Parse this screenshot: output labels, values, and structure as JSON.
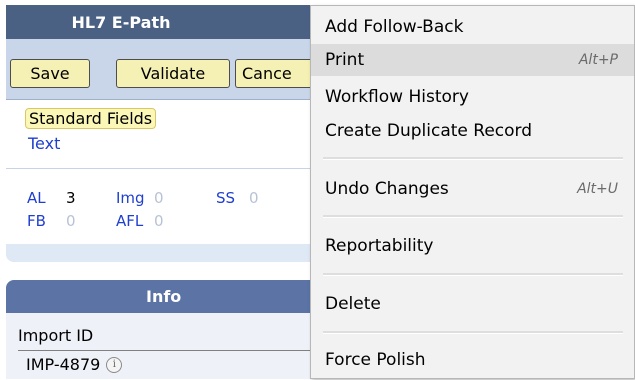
{
  "panel": {
    "title": "HL7 E-Path",
    "buttons": {
      "save": "Save",
      "validate": "Validate",
      "cancel": "Cance"
    },
    "links": {
      "standard_fields": "Standard Fields",
      "text": "Text"
    },
    "counts": [
      {
        "label": "AL",
        "value": "3"
      },
      {
        "label": "Img",
        "value": "0"
      },
      {
        "label": "SS",
        "value": "0"
      },
      {
        "label": "FB",
        "value": "0"
      },
      {
        "label": "AFL",
        "value": "0"
      }
    ]
  },
  "info": {
    "title": "Info",
    "import_id_label": "Import ID",
    "import_id_value": "IMP-4879",
    "info_icon": "info-circle-icon"
  },
  "menu": {
    "items": [
      {
        "label": "Add Follow-Back",
        "shortcut": ""
      },
      {
        "label": "Print",
        "shortcut": "Alt+P",
        "highlighted": true
      },
      {
        "label": "Workflow History",
        "shortcut": ""
      },
      {
        "label": "Create Duplicate Record",
        "shortcut": ""
      },
      {
        "label": "Undo Changes",
        "shortcut": "Alt+U"
      },
      {
        "label": "Reportability",
        "shortcut": ""
      },
      {
        "label": "Delete",
        "shortcut": ""
      },
      {
        "label": "Force Polish",
        "shortcut": ""
      }
    ]
  },
  "colors": {
    "header_bg": "#4a6184",
    "info_header_bg": "#5b73a5",
    "button_bg": "#f5f0b3",
    "link_blue": "#1f3fcf",
    "menu_bg": "#f2f2f2",
    "menu_highlight": "#dcdcdc"
  }
}
